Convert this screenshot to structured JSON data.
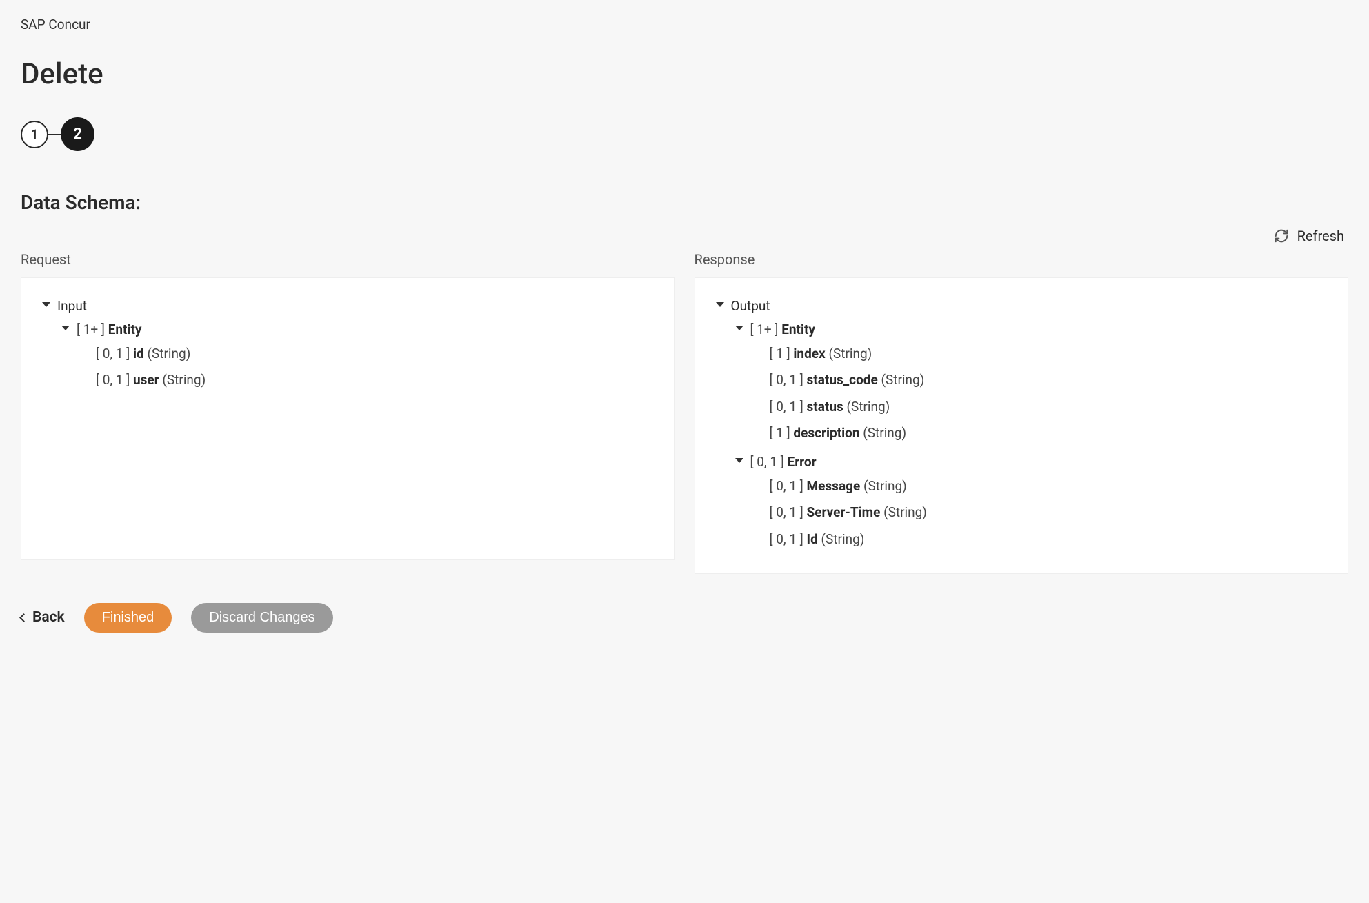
{
  "breadcrumb": "SAP Concur",
  "page_title": "Delete",
  "stepper": {
    "step1": "1",
    "step2": "2"
  },
  "section_title": "Data Schema:",
  "refresh_label": "Refresh",
  "request_label": "Request",
  "response_label": "Response",
  "request_tree": {
    "root": "Input",
    "entity_card": "[ 1+ ]",
    "entity_name": "Entity",
    "fields": [
      {
        "card": "[ 0, 1 ]",
        "name": "id",
        "type": "(String)"
      },
      {
        "card": "[ 0, 1 ]",
        "name": "user",
        "type": "(String)"
      }
    ]
  },
  "response_tree": {
    "root": "Output",
    "entity_card": "[ 1+ ]",
    "entity_name": "Entity",
    "entity_fields": [
      {
        "card": "[ 1 ]",
        "name": "index",
        "type": "(String)"
      },
      {
        "card": "[ 0, 1 ]",
        "name": "status_code",
        "type": "(String)"
      },
      {
        "card": "[ 0, 1 ]",
        "name": "status",
        "type": "(String)"
      },
      {
        "card": "[ 1 ]",
        "name": "description",
        "type": "(String)"
      }
    ],
    "error_card": "[ 0, 1 ]",
    "error_name": "Error",
    "error_fields": [
      {
        "card": "[ 0, 1 ]",
        "name": "Message",
        "type": "(String)"
      },
      {
        "card": "[ 0, 1 ]",
        "name": "Server-Time",
        "type": "(String)"
      },
      {
        "card": "[ 0, 1 ]",
        "name": "Id",
        "type": "(String)"
      }
    ]
  },
  "footer": {
    "back": "Back",
    "finished": "Finished",
    "discard": "Discard Changes"
  }
}
